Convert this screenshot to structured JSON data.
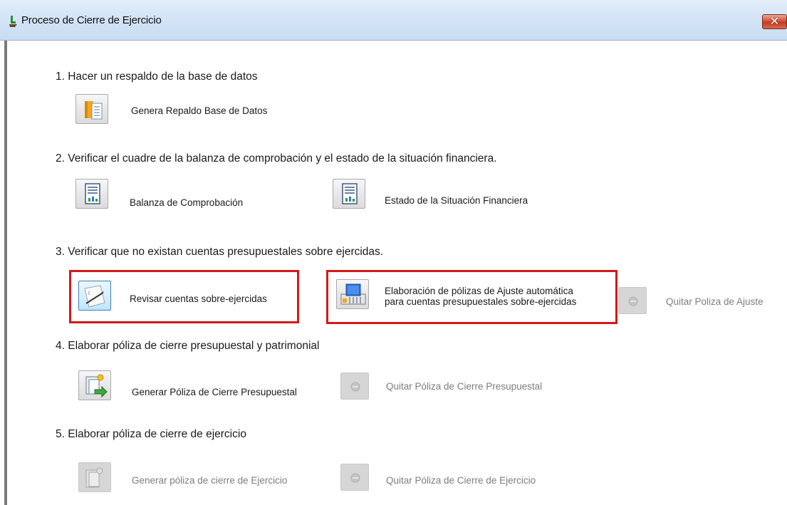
{
  "window": {
    "title": "Proceso de Cierre de Ejercicio",
    "close_glyph": "✕"
  },
  "steps": [
    {
      "heading": "1.  Hacer un respaldo de la base de datos",
      "actions": [
        {
          "label": "Genera Repaldo Base de Datos",
          "icon": "database-backup-icon",
          "enabled": true
        }
      ]
    },
    {
      "heading": "2.  Verificar el cuadre de la balanza de comprobación y el estado de la situación financiera.",
      "actions": [
        {
          "label": "Balanza de Comprobación",
          "icon": "report-icon",
          "enabled": true
        },
        {
          "label": "Estado de la Situación Financiera",
          "icon": "report-icon",
          "enabled": true
        }
      ]
    },
    {
      "heading": "3.  Verificar que no existan cuentas presupuestales sobre ejercidas.",
      "actions": [
        {
          "label": "Revisar cuentas sobre-ejercidas",
          "icon": "review-pen-icon",
          "enabled": true,
          "highlighted": true
        },
        {
          "label_line1": "Elaboración de pólizas de Ajuste automática",
          "label_line2": "para cuentas presupuestales sobre-ejercidas",
          "icon": "adjustment-policy-icon",
          "enabled": true,
          "highlighted": true
        },
        {
          "label": "Quitar Poliza de Ajuste",
          "icon": "remove-icon",
          "enabled": false
        }
      ]
    },
    {
      "heading": "4. Elaborar póliza de cierre presupuestal y patrimonial",
      "actions": [
        {
          "label": "Generar Póliza de Cierre Presupuestal",
          "icon": "generate-policy-icon",
          "enabled": true
        },
        {
          "label": "Quitar Póliza de Cierre Presupuestal",
          "icon": "remove-icon",
          "enabled": false
        }
      ]
    },
    {
      "heading": "5. Elaborar póliza de cierre de ejercicio",
      "actions": [
        {
          "label": "Generar póliza de cierre de Ejercicio",
          "icon": "closing-policy-icon",
          "enabled": false
        },
        {
          "label": "Quitar Póliza de Cierre de Ejercicio",
          "icon": "remove-icon",
          "enabled": false
        }
      ]
    }
  ],
  "colors": {
    "highlight_border": "#d11a1a",
    "titlebar": "#d4e4f6",
    "disabled_text": "#7d7d7d"
  }
}
